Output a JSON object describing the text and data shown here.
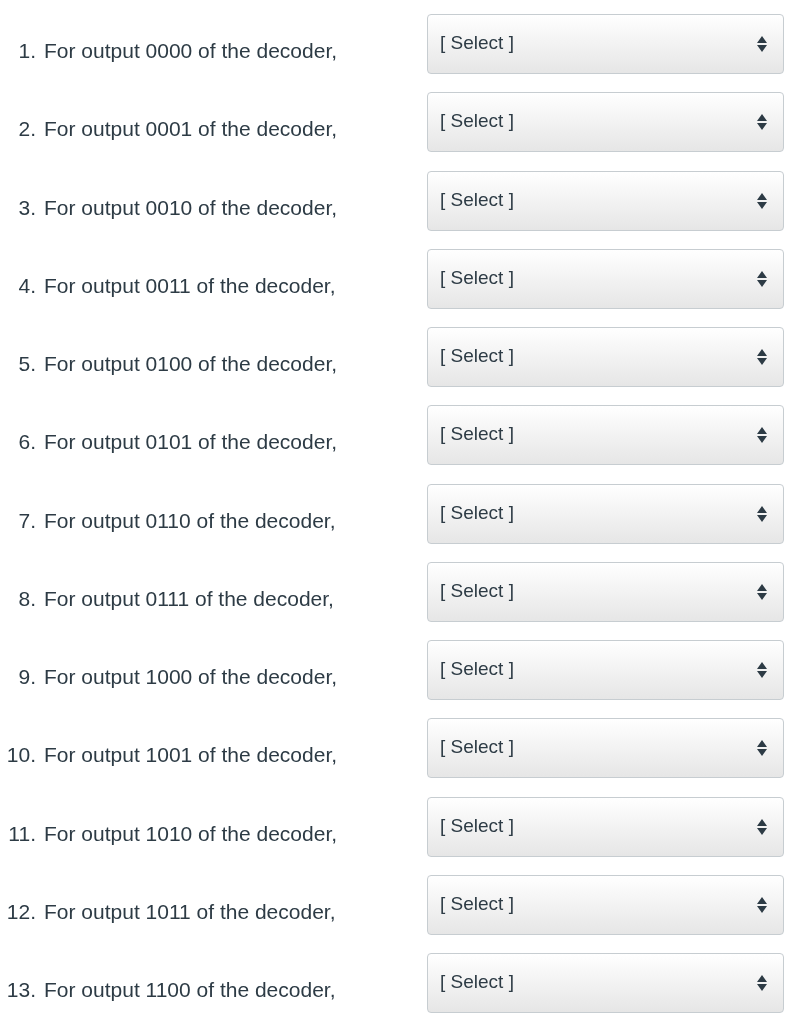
{
  "questions": [
    {
      "number": "1.",
      "text": "For output 0000 of the decoder,",
      "dropdown": {
        "value": "[ Select ]"
      }
    },
    {
      "number": "2.",
      "text": "For output 0001 of the decoder,",
      "dropdown": {
        "value": "[ Select ]"
      }
    },
    {
      "number": "3.",
      "text": "For output 0010 of the decoder,",
      "dropdown": {
        "value": "[ Select ]"
      }
    },
    {
      "number": "4.",
      "text": "For output 0011 of the decoder,",
      "dropdown": {
        "value": "[ Select ]"
      }
    },
    {
      "number": "5.",
      "text": "For output 0100 of the decoder,",
      "dropdown": {
        "value": "[ Select ]"
      }
    },
    {
      "number": "6.",
      "text": "For output 0101 of the decoder,",
      "dropdown": {
        "value": "[ Select ]"
      }
    },
    {
      "number": "7.",
      "text": "For output 0110 of the decoder,",
      "dropdown": {
        "value": "[ Select ]"
      }
    },
    {
      "number": "8.",
      "text": "For output 0111 of the decoder,",
      "dropdown": {
        "value": "[ Select ]"
      }
    },
    {
      "number": "9.",
      "text": "For output 1000 of the decoder,",
      "dropdown": {
        "value": "[ Select ]"
      }
    },
    {
      "number": "10.",
      "text": "For output 1001 of the decoder,",
      "dropdown": {
        "value": "[ Select ]"
      }
    },
    {
      "number": "11.",
      "text": "For output 1010 of the decoder,",
      "dropdown": {
        "value": "[ Select ]"
      }
    },
    {
      "number": "12.",
      "text": "For output 1011 of the decoder,",
      "dropdown": {
        "value": "[ Select ]"
      }
    },
    {
      "number": "13.",
      "text": "For output 1100 of the decoder,",
      "dropdown": {
        "value": "[ Select ]"
      }
    }
  ]
}
